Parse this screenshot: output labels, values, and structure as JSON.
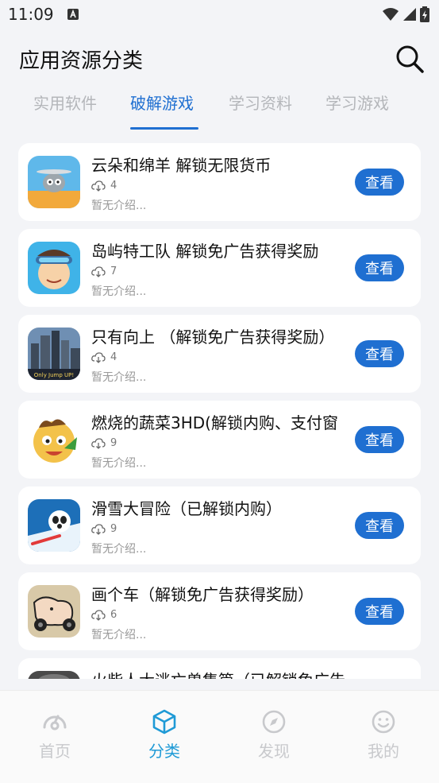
{
  "status_bar": {
    "time": "11:09"
  },
  "header": {
    "title": "应用资源分类"
  },
  "tabs": [
    {
      "label": "实用软件",
      "active": false
    },
    {
      "label": "破解游戏",
      "active": true
    },
    {
      "label": "学习资料",
      "active": false
    },
    {
      "label": "学习游戏",
      "active": false
    }
  ],
  "items": [
    {
      "name": "云朵和绵羊 解锁无限货币",
      "downloads": "4",
      "desc": "暂无介绍...",
      "button": "查看"
    },
    {
      "name": "岛屿特工队 解锁免广告获得奖励",
      "downloads": "7",
      "desc": "暂无介绍...",
      "button": "查看"
    },
    {
      "name": "只有向上 （解锁免广告获得奖励）",
      "downloads": "4",
      "desc": "暂无介绍...",
      "button": "查看",
      "thumb_text": "Only Jump UP!"
    },
    {
      "name": "燃烧的蔬菜3HD(解锁内购、支付窗",
      "downloads": "9",
      "desc": "暂无介绍...",
      "button": "查看"
    },
    {
      "name": "滑雪大冒险（已解锁内购）",
      "downloads": "9",
      "desc": "暂无介绍...",
      "button": "查看"
    },
    {
      "name": "画个车（解锁免广告获得奖励）",
      "downloads": "6",
      "desc": "暂无介绍...",
      "button": "查看"
    },
    {
      "name": "火柴人大逃亡兽集篇（已解锁免广告",
      "downloads": "",
      "desc": "",
      "button": ""
    }
  ],
  "bottom_nav": [
    {
      "label": "首页",
      "icon": "dashboard-icon",
      "active": false
    },
    {
      "label": "分类",
      "icon": "cube-icon",
      "active": true
    },
    {
      "label": "发现",
      "icon": "compass-icon",
      "active": false
    },
    {
      "label": "我的",
      "icon": "smiley-icon",
      "active": false
    }
  ],
  "colors": {
    "accent": "#1f6fd1",
    "nav_active": "#1f9ad6",
    "inactive": "#b4b6ba"
  }
}
